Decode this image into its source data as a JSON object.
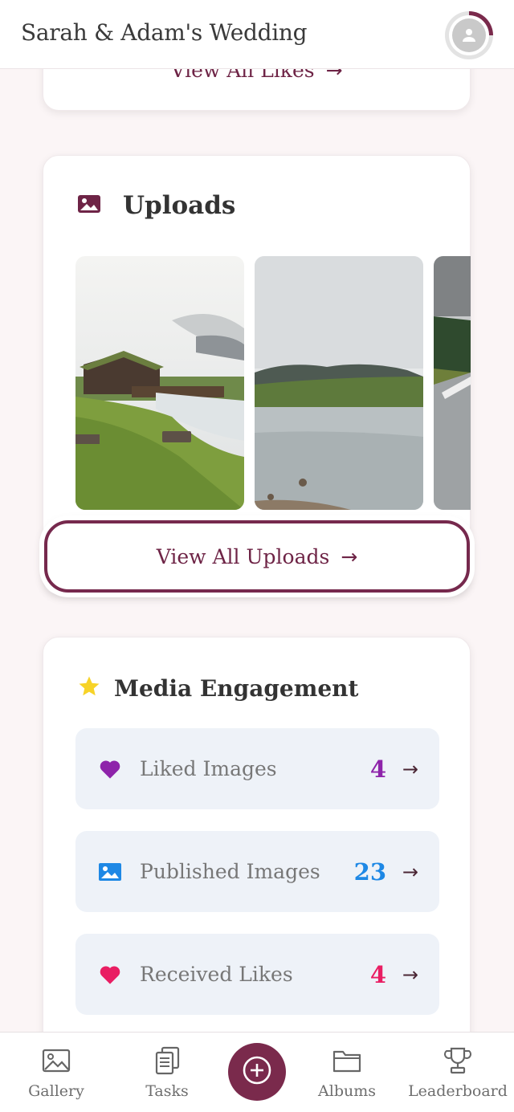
{
  "header": {
    "title": "Sarah & Adam's Wedding",
    "avatar_icon": "user-avatar-icon"
  },
  "likes_section": {
    "view_all_label": "View All Likes"
  },
  "uploads_section": {
    "title": "Uploads",
    "icon": "image-icon",
    "view_all_label": "View All Uploads"
  },
  "engagement": {
    "title": "Media Engagement",
    "icon": "star-icon",
    "items": [
      {
        "label": "Liked Images",
        "value": "4",
        "icon": "purple-heart-icon",
        "color": "#8e24aa"
      },
      {
        "label": "Published Images",
        "value": "23",
        "icon": "picture-icon",
        "color": "#1e88e5"
      },
      {
        "label": "Received Likes",
        "value": "4",
        "icon": "red-heart-icon",
        "color": "#e91e63"
      }
    ]
  },
  "nav": {
    "items": [
      {
        "label": "Gallery",
        "icon": "gallery-icon"
      },
      {
        "label": "Tasks",
        "icon": "tasks-icon"
      },
      {
        "label": "Albums",
        "icon": "folder-icon"
      },
      {
        "label": "Leaderboard",
        "icon": "trophy-icon"
      }
    ],
    "fab_icon": "add-icon"
  },
  "colors": {
    "brand": "#7a2a4c",
    "background": "#fbf5f6"
  }
}
